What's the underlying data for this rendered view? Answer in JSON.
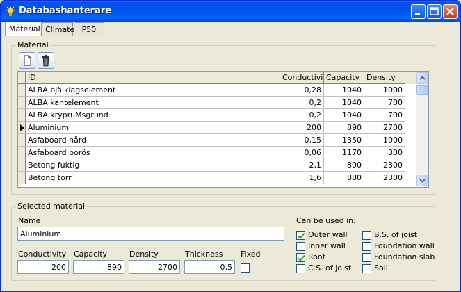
{
  "window": {
    "title": "Databashanterare"
  },
  "tabs": [
    {
      "label": "Material",
      "active": true
    },
    {
      "label": "Climate",
      "active": false
    },
    {
      "label": "P50",
      "active": false
    }
  ],
  "material_group": {
    "label": "Material",
    "toolbar": {
      "new_icon": "new-document-icon",
      "delete_icon": "trash-icon"
    },
    "columns": [
      "ID",
      "Conductivity",
      "Capacity",
      "Density"
    ],
    "rows": [
      {
        "id": "ALBA bjälklagselement",
        "conductivity": "0,28",
        "capacity": "1040",
        "density": "1000",
        "current": false
      },
      {
        "id": "ALBA kantelement",
        "conductivity": "0,2",
        "capacity": "1040",
        "density": "700",
        "current": false
      },
      {
        "id": "ALBA krypruMsgrund",
        "conductivity": "0,2",
        "capacity": "1040",
        "density": "700",
        "current": false
      },
      {
        "id": "Aluminium",
        "conductivity": "200",
        "capacity": "890",
        "density": "2700",
        "current": true
      },
      {
        "id": "Asfaboard hård",
        "conductivity": "0,15",
        "capacity": "1350",
        "density": "1000",
        "current": false
      },
      {
        "id": "Asfaboard porös",
        "conductivity": "0,06",
        "capacity": "1170",
        "density": "300",
        "current": false
      },
      {
        "id": "Betong fuktig",
        "conductivity": "2,1",
        "capacity": "800",
        "density": "2300",
        "current": false
      },
      {
        "id": "Betong torr",
        "conductivity": "1,6",
        "capacity": "880",
        "density": "2300",
        "current": false
      }
    ]
  },
  "selected_group": {
    "label": "Selected material",
    "name_label": "Name",
    "name_value": "Aluminium",
    "conductivity_label": "Conductivity",
    "conductivity_value": "200",
    "capacity_label": "Capacity",
    "capacity_value": "890",
    "density_label": "Density",
    "density_value": "2700",
    "thickness_label": "Thickness",
    "thickness_value": "0,5",
    "fixed_label": "Fixed",
    "fixed_checked": false,
    "usage_label": "Can be used in:",
    "usage": [
      {
        "label": "Outer wall",
        "checked": true
      },
      {
        "label": "Inner wall",
        "checked": false
      },
      {
        "label": "Roof",
        "checked": true
      },
      {
        "label": "C.S. of joist",
        "checked": false
      },
      {
        "label": "B.S. of joist",
        "checked": false
      },
      {
        "label": "Foundation wall",
        "checked": false
      },
      {
        "label": "Foundation slab",
        "checked": false
      },
      {
        "label": "Soil",
        "checked": false
      }
    ]
  }
}
